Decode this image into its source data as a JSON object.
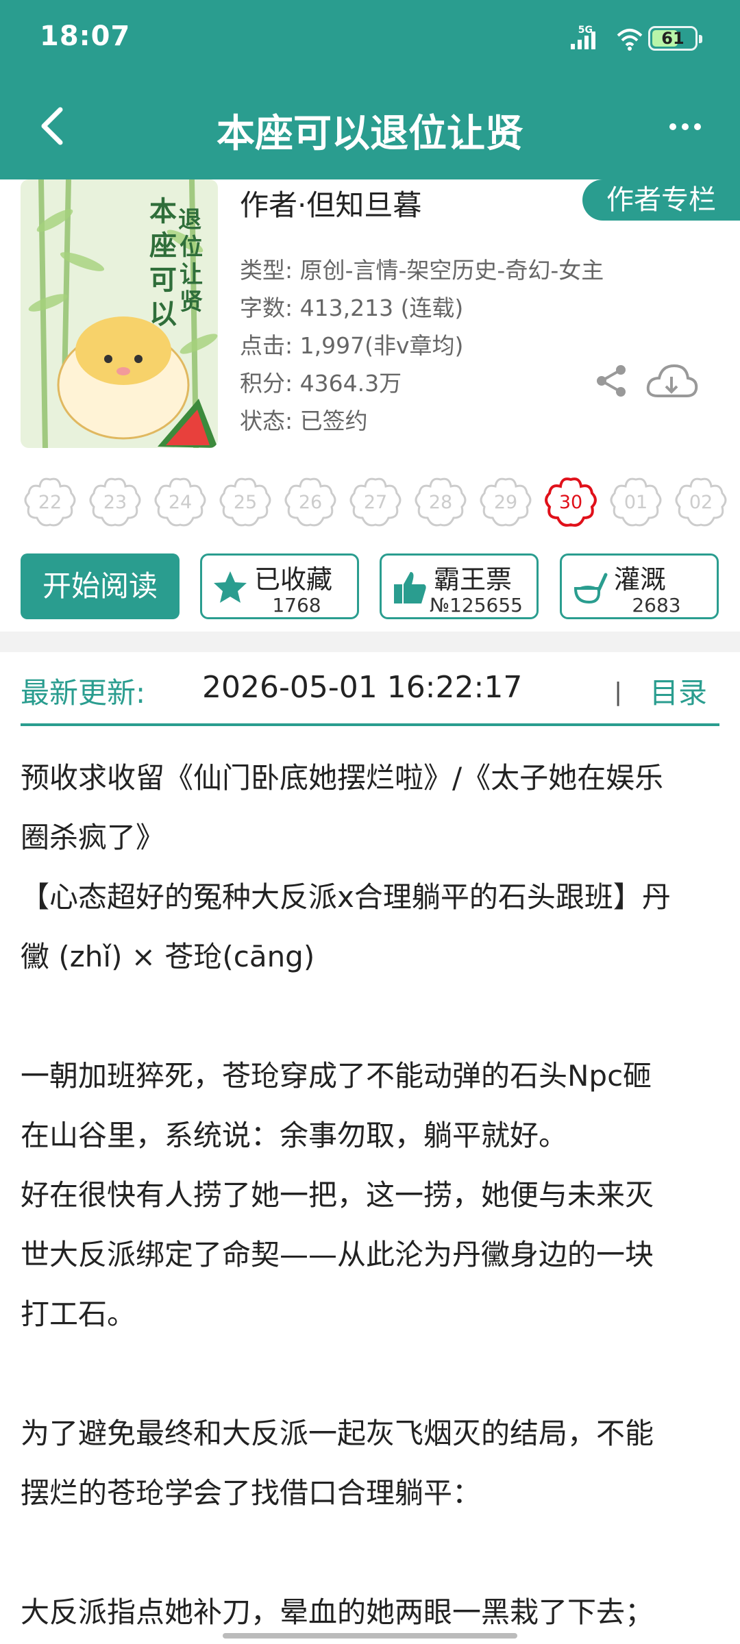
{
  "status_bar": {
    "time": "18:07",
    "network": "5G",
    "battery": "61",
    "battery_level": 0.61
  },
  "header": {
    "title": "本座可以退位让贤",
    "back_icon": "chevron-left-icon",
    "more_icon": "more-horizontal-icon"
  },
  "book": {
    "cover_title": "本座可以退位让贤",
    "author": "作者·但知旦暮",
    "author_column_button": "作者专栏",
    "meta": [
      {
        "key": "类型: ",
        "value": "原创-言情-架空历史-奇幻-女主"
      },
      {
        "key": "字数: ",
        "value": "413,213 (连载)"
      },
      {
        "key": "点击: ",
        "value": "1,997(非v章均)"
      },
      {
        "key": "积分: ",
        "value": "4364.3万"
      },
      {
        "key": "状态: ",
        "value": "已签约"
      }
    ]
  },
  "days": [
    "22",
    "23",
    "24",
    "25",
    "26",
    "27",
    "28",
    "29",
    "30",
    "01",
    "02"
  ],
  "active_day": "30",
  "actions": {
    "read": "开始阅读",
    "collect": {
      "label": "已收藏",
      "count": "1768"
    },
    "ticket": {
      "label": "霸王票",
      "count": "№125655"
    },
    "water": {
      "label": "灌溉",
      "count": "2683"
    }
  },
  "update": {
    "label": "最新更新:",
    "datetime": "2026-05-01 16:22:17",
    "divider": "|",
    "toc": "目录"
  },
  "description": [
    "预收求收留《仙门卧底她摆烂啦》/《太子她在娱乐",
    "圈杀疯了》",
    "【心态超好的冤种大反派x合理躺平的石头跟班】丹",
    "黴 (zhǐ) × 苍玱(cāng)",
    "",
    "一朝加班猝死，苍玱穿成了不能动弹的石头Npc砸",
    "在山谷里，系统说：余事勿取，躺平就好。",
    "好在很快有人捞了她一把，这一捞，她便与未来灭",
    "世大反派绑定了命契——从此沦为丹黴身边的一块",
    "打工石。",
    "",
    "为了避免最终和大反派一起灰飞烟灭的结局，不能",
    "摆烂的苍玱学会了找借口合理躺平：",
    "",
    "大反派指点她补刀，晕血的她两眼一黑栽了下去；"
  ],
  "colors": {
    "accent": "#2a9d8f",
    "active_day": "#e0101a"
  }
}
